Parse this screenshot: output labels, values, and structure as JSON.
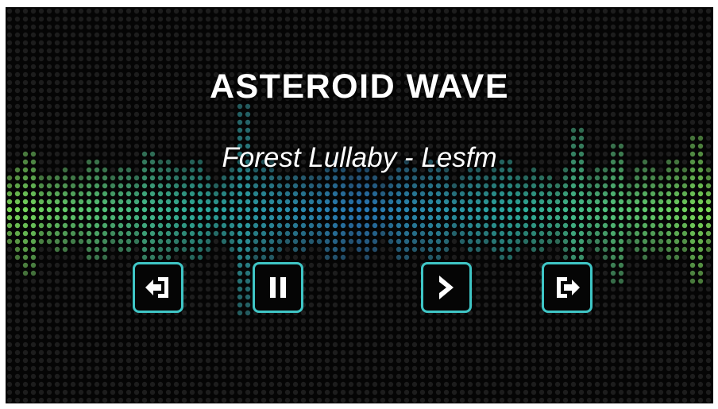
{
  "game": {
    "title": "ASTEROID WAVE"
  },
  "player": {
    "now_playing": "Forest Lullaby - Lesfm"
  },
  "controls": [
    {
      "name": "previous-track-button",
      "icon": "exit-left-icon"
    },
    {
      "name": "pause-button",
      "icon": "pause-icon"
    },
    {
      "name": "next-track-button",
      "icon": "chevron-right-icon"
    },
    {
      "name": "exit-button",
      "icon": "exit-right-icon"
    }
  ],
  "colors": {
    "background": "#050505",
    "button_border": "#3fc6c6",
    "visualizer_green": "#7fe05a",
    "visualizer_teal": "#2fb0a0",
    "visualizer_blue": "#2a7ab8",
    "text": "#ffffff"
  }
}
